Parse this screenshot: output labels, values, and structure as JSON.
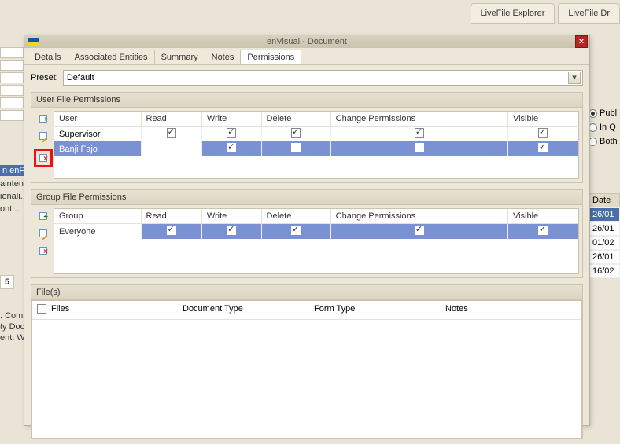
{
  "background": {
    "tabs": [
      "LiveFile Explorer",
      "LiveFile Dr"
    ],
    "leftRows": [
      "",
      "",
      "",
      "",
      ""
    ],
    "leftSel1": "n enPr..",
    "leftItems": [
      "ainten..",
      "ionali..",
      "ont..."
    ],
    "below": [
      ": Com",
      "ty Doc",
      "ent: W"
    ],
    "cell5": "5",
    "radios": [
      {
        "label": "Publ",
        "selected": true
      },
      {
        "label": "In Q",
        "selected": false
      },
      {
        "label": "Both",
        "selected": false
      }
    ],
    "dateHeader": "Date ",
    "dates": [
      {
        "text": "26/01",
        "selected": true
      },
      {
        "text": "26/01",
        "selected": false
      },
      {
        "text": "01/02",
        "selected": false
      },
      {
        "text": "26/01",
        "selected": false
      },
      {
        "text": "16/02",
        "selected": false
      }
    ]
  },
  "dialog": {
    "title": "enVisual - Document",
    "tabs": [
      "Details",
      "Associated Entities",
      "Summary",
      "Notes",
      "Permissions"
    ],
    "activeTab": 4,
    "presetLabel": "Preset:",
    "presetValue": "Default",
    "userSection": {
      "title": "User File Permissions",
      "columns": [
        "User",
        "Read",
        "Write",
        "Delete",
        "Change Permissions",
        "Visible"
      ],
      "rows": [
        {
          "name": "Supervisor",
          "read": true,
          "write": true,
          "delete": true,
          "change": true,
          "visible": true,
          "selected": false
        },
        {
          "name": "Banji Fajo",
          "read": false,
          "write": true,
          "delete": false,
          "change": false,
          "visible": true,
          "selected": true
        }
      ]
    },
    "groupSection": {
      "title": "Group File Permissions",
      "columns": [
        "Group",
        "Read",
        "Write",
        "Delete",
        "Change Permissions",
        "Visible"
      ],
      "rows": [
        {
          "name": "Everyone",
          "read": true,
          "write": true,
          "delete": true,
          "change": true,
          "visible": true,
          "selected": true
        }
      ]
    },
    "filesSection": {
      "title": "File(s)",
      "columns": [
        "Files",
        "Document Type",
        "Form Type",
        "Notes"
      ]
    }
  }
}
